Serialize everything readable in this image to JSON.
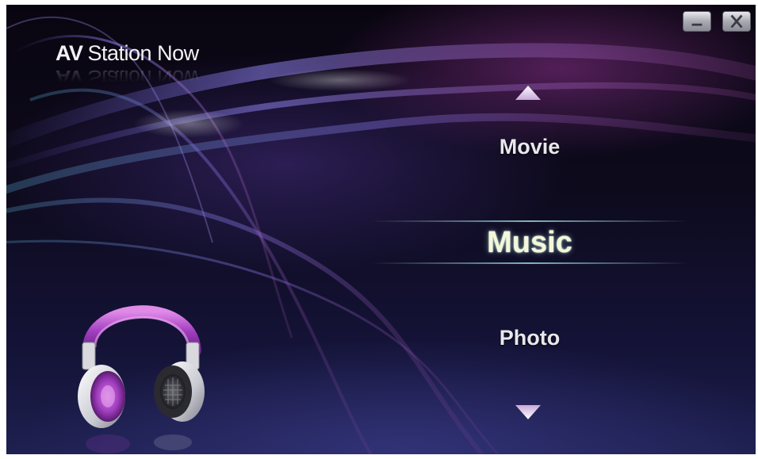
{
  "app": {
    "logo_prefix": "AV",
    "logo_suffix": "Station Now"
  },
  "window_controls": {
    "minimize_icon": "minimize-icon",
    "close_icon": "close-icon"
  },
  "menu": {
    "scroll_up_icon": "triangle-up-icon",
    "scroll_down_icon": "triangle-down-icon",
    "items": [
      {
        "label": "Movie",
        "selected": false
      },
      {
        "label": "Music",
        "selected": true
      },
      {
        "label": "Photo",
        "selected": false
      }
    ]
  },
  "illustration": {
    "icon": "headphones-icon"
  },
  "colors": {
    "background_dark": "#0d0a1c",
    "accent_purple": "#a23fc0",
    "selected_text": "#f4f8d8",
    "menu_text": "#e8e8ec"
  }
}
